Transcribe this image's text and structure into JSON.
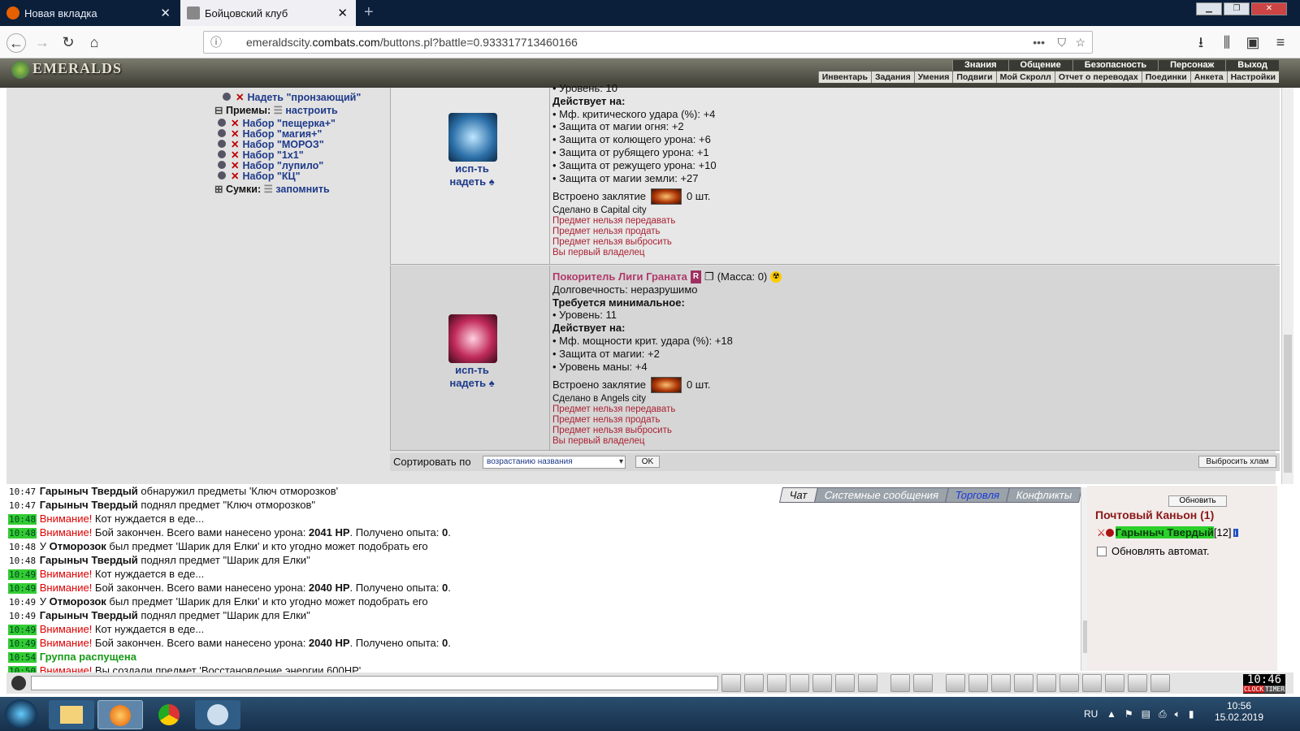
{
  "browser": {
    "tabs": [
      {
        "label": "Новая вкладка"
      },
      {
        "label": "Бойцовский клуб"
      }
    ],
    "url": {
      "prefix": "emeraldscity.",
      "domain": "combats.com",
      "path": "/buttons.pl?battle=0.933317713460166"
    }
  },
  "game": {
    "logo": "EMERALDS",
    "top_menu": [
      "Знания",
      "Общение",
      "Безопасность",
      "Персонаж",
      "Выход"
    ],
    "sub_menu": [
      "Инвентарь",
      "Задания",
      "Умения",
      "Подвиги",
      "Мой Скролл",
      "Отчет о переводах",
      "Поединки",
      "Анкета",
      "Настройки"
    ]
  },
  "left_panel": {
    "put_on": "Надеть \"пронзающий\"",
    "techniques_label": "Приемы:",
    "configure": "настроить",
    "sets": [
      "Набор \"пещерка+\"",
      "Набор \"магия+\"",
      "Набор \"МОРОЗ\"",
      "Набор \"1х1\"",
      "Набор \"лупило\"",
      "Набор \"КЦ\""
    ],
    "bags_label": "Сумки:",
    "remember": "запомнить"
  },
  "items": [
    {
      "use": "исп-ть",
      "equip": "надеть",
      "top_cut": "• Уровень: 10",
      "acts_title": "Действует на:",
      "effects": [
        "• Мф. критического удара (%): +4",
        "• Защита от магии огня: +2",
        "• Защита от колющего урона: +6",
        "• Защита от рубящего урона: +1",
        "• Защита от режущего урона: +10",
        "• Защита от магии земли: +27"
      ],
      "spell_label": "Встроено заклятие",
      "spell_count": "0 шт.",
      "made_in": "Сделано в Capital city",
      "restrictions": [
        "Предмет нельзя передавать",
        "Предмет нельзя продать",
        "Предмет нельзя выбросить",
        "Вы первый владелец"
      ]
    },
    {
      "use": "исп-ть",
      "equip": "надеть",
      "name": "Покоритель Лиги Граната",
      "badge": "R",
      "mass": "(Масса: 0)",
      "durability": "Долговечность: неразрушимо",
      "req_title": "Требуется минимальное:",
      "req_level": "• Уровень: 11",
      "acts_title": "Действует на:",
      "effects": [
        "• Мф. мощности крит. удара (%): +18",
        "• Защита от магии: +2",
        "• Уровень маны: +4"
      ],
      "spell_label": "Встроено заклятие",
      "spell_count": "0 шт.",
      "made_in": "Сделано в Angels city",
      "restrictions": [
        "Предмет нельзя передавать",
        "Предмет нельзя продать",
        "Предмет нельзя выбросить",
        "Вы первый владелец"
      ]
    }
  ],
  "sort_bar": {
    "label": "Сортировать по",
    "selected": "возрастанию названия",
    "ok": "OK",
    "discard": "Выбросить хлам"
  },
  "chat_tabs": [
    "Чат",
    "Системные сообщения",
    "Торговля",
    "Конфликты"
  ],
  "chat": [
    {
      "time": "10:47",
      "hl": false,
      "parts": [
        {
          "t": "Гарыныч Твердый",
          "b": true
        },
        {
          "t": " обнаружил предметы 'Ключ отморозков'"
        }
      ]
    },
    {
      "time": "10:47",
      "hl": false,
      "parts": [
        {
          "t": "Гарыныч Твердый",
          "b": true
        },
        {
          "t": " поднял предмет \"Ключ отморозков\""
        }
      ]
    },
    {
      "time": "10:48",
      "hl": true,
      "parts": [
        {
          "t": "Внимание!",
          "red": true
        },
        {
          "t": " Кот нуждается в еде..."
        }
      ]
    },
    {
      "time": "10:48",
      "hl": true,
      "parts": [
        {
          "t": "Внимание!",
          "red": true
        },
        {
          "t": " Бой закончен. Всего вами нанесено урона: "
        },
        {
          "t": "2041 HP",
          "b": true
        },
        {
          "t": ". Получено опыта: "
        },
        {
          "t": "0",
          "b": true
        },
        {
          "t": "."
        }
      ]
    },
    {
      "time": "10:48",
      "hl": false,
      "parts": [
        {
          "t": "У "
        },
        {
          "t": "Отморозок",
          "b": true
        },
        {
          "t": " был предмет 'Шарик для Елки' и кто угодно может подобрать его"
        }
      ]
    },
    {
      "time": "10:48",
      "hl": false,
      "parts": [
        {
          "t": "Гарыныч Твердый",
          "b": true
        },
        {
          "t": " поднял предмет \"Шарик для Елки\""
        }
      ]
    },
    {
      "time": "10:49",
      "hl": true,
      "parts": [
        {
          "t": "Внимание!",
          "red": true
        },
        {
          "t": " Кот нуждается в еде..."
        }
      ]
    },
    {
      "time": "10:49",
      "hl": true,
      "parts": [
        {
          "t": "Внимание!",
          "red": true
        },
        {
          "t": " Бой закончен. Всего вами нанесено урона: "
        },
        {
          "t": "2040 HP",
          "b": true
        },
        {
          "t": ". Получено опыта: "
        },
        {
          "t": "0",
          "b": true
        },
        {
          "t": "."
        }
      ]
    },
    {
      "time": "10:49",
      "hl": false,
      "parts": [
        {
          "t": "У "
        },
        {
          "t": "Отморозок",
          "b": true
        },
        {
          "t": " был предмет 'Шарик для Елки' и кто угодно может подобрать его"
        }
      ]
    },
    {
      "time": "10:49",
      "hl": false,
      "parts": [
        {
          "t": "Гарыныч Твердый",
          "b": true
        },
        {
          "t": " поднял предмет \"Шарик для Елки\""
        }
      ]
    },
    {
      "time": "10:49",
      "hl": true,
      "parts": [
        {
          "t": "Внимание!",
          "red": true
        },
        {
          "t": " Кот нуждается в еде..."
        }
      ]
    },
    {
      "time": "10:49",
      "hl": true,
      "parts": [
        {
          "t": "Внимание!",
          "red": true
        },
        {
          "t": " Бой закончен. Всего вами нанесено урона: "
        },
        {
          "t": "2040 HP",
          "b": true
        },
        {
          "t": ". Получено опыта: "
        },
        {
          "t": "0",
          "b": true
        },
        {
          "t": "."
        }
      ]
    },
    {
      "time": "10:54",
      "hl": true,
      "parts": [
        {
          "t": "Группа распущена",
          "green": true
        }
      ]
    },
    {
      "time": "10:50",
      "hl": true,
      "parts": [
        {
          "t": "Внимание!",
          "red": true
        },
        {
          "t": " Вы создали предмет 'Восстановление энергии 600HP'"
        }
      ]
    }
  ],
  "right_panel": {
    "refresh": "Обновить",
    "location": "Почтовый Каньон (1)",
    "player": "Гарыныч Твердый",
    "level": "[12]",
    "auto": "Обновлять автомат."
  },
  "clock": {
    "time": "10:46",
    "labels": [
      "CLOCK",
      "TIMER"
    ]
  },
  "taskbar": {
    "lang": "RU",
    "time": "10:56",
    "date": "15.02.2019"
  },
  "colors": {
    "link": "#1e3a8a",
    "alert": "#dd0000",
    "time_hl": "#33cc33",
    "panel": "#e2e2e2"
  }
}
